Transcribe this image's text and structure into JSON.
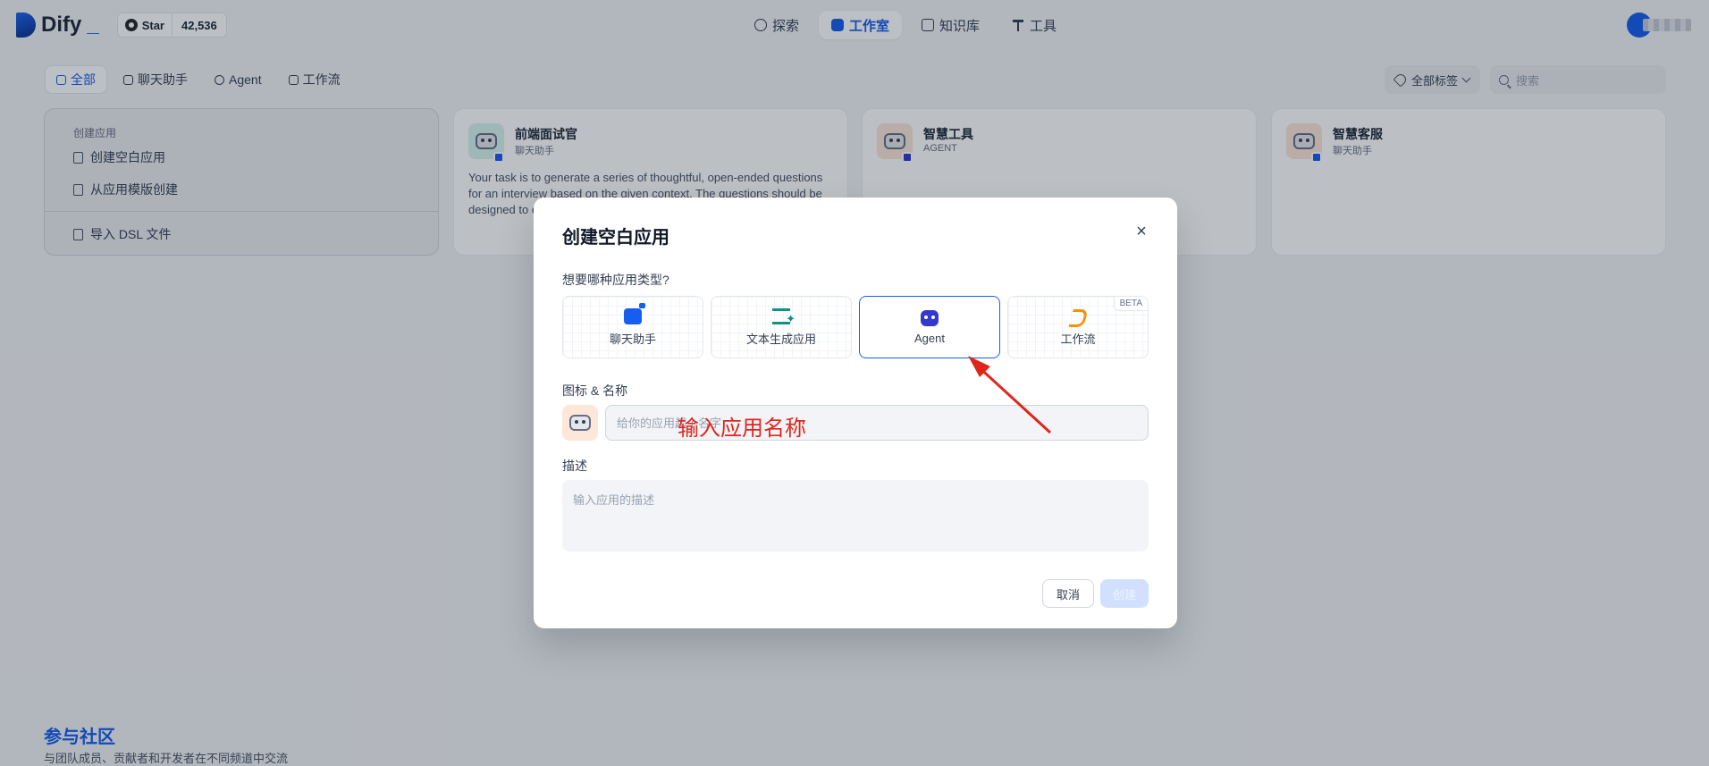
{
  "header": {
    "logo_text": "Dify",
    "logo_suffix": "_",
    "github": {
      "star_label": "Star",
      "star_count": "42,536"
    },
    "nav": [
      {
        "label": "探索",
        "icon": "compass-icon"
      },
      {
        "label": "工作室",
        "icon": "robot-icon",
        "active": true
      },
      {
        "label": "知识库",
        "icon": "book-icon"
      },
      {
        "label": "工具",
        "icon": "hammer-icon"
      }
    ]
  },
  "toolbar": {
    "tabs": [
      {
        "label": "全部",
        "active": true
      },
      {
        "label": "聊天助手"
      },
      {
        "label": "Agent"
      },
      {
        "label": "工作流"
      }
    ],
    "tag_filter_label": "全部标签",
    "search_placeholder": "搜索"
  },
  "create_card": {
    "title": "创建应用",
    "items": [
      "创建空白应用",
      "从应用模版创建",
      "导入 DSL 文件"
    ]
  },
  "apps": [
    {
      "name": "前端面试官",
      "type": "聊天助手",
      "icon_bg": "#d5f5ef",
      "description": "Your task is to generate a series of thoughtful, open-ended questions for an interview based on the given context. The questions should be designed to e... interviewee, a..."
    },
    {
      "name": "智慧工具",
      "type": "AGENT",
      "icon_bg": "#fde7d8",
      "description": ""
    },
    {
      "name": "智慧客服",
      "type": "聊天助手",
      "icon_bg": "#fde7d8",
      "description": ""
    }
  ],
  "footer": {
    "community_title": "参与社区",
    "community_subtitle": "与团队成员、贡献者和开发者在不同频道中交流"
  },
  "modal": {
    "title": "创建空白应用",
    "close_symbol": "×",
    "type_question": "想要哪种应用类型?",
    "types": [
      {
        "label": "聊天助手",
        "icon": "chat-bot-icon",
        "selected": false
      },
      {
        "label": "文本生成应用",
        "icon": "text-generation-icon",
        "selected": false
      },
      {
        "label": "Agent",
        "icon": "agent-icon",
        "selected": true
      },
      {
        "label": "工作流",
        "icon": "workflow-icon",
        "selected": false,
        "badge": "BETA"
      }
    ],
    "name_label": "图标 & 名称",
    "name_placeholder": "给你的应用起个名字",
    "description_label": "描述",
    "description_placeholder": "输入应用的描述",
    "cancel_label": "取消",
    "create_label": "创建"
  },
  "annotation": {
    "text": "输入应用名称",
    "color": "#e0251b"
  },
  "colors": {
    "accent": "#155eef",
    "background": "#f2f4f7"
  }
}
